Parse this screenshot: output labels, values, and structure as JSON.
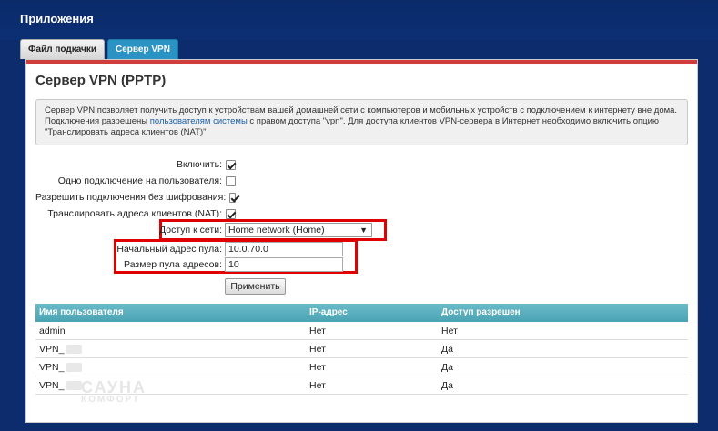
{
  "header": {
    "title": "Приложения"
  },
  "tabs": [
    {
      "label": "Файл подкачки",
      "active": false
    },
    {
      "label": "Сервер VPN",
      "active": true
    }
  ],
  "page": {
    "title": "Сервер VPN (PPTP)",
    "info_part1": "Сервер VPN позволяет получить доступ к устройствам вашей домашней сети с компьютеров и мобильных устройств с подключением к интернету вне дома. Подключения разрешены ",
    "info_link": "пользователям системы",
    "info_part2": " с правом доступа \"vpn\". Для доступа клиентов VPN-сервера в Интернет необходимо включить опцию \"Транслировать адреса клиентов (NAT)\""
  },
  "form": {
    "enable_label": "Включить:",
    "single_conn_label": "Одно подключение на пользователя:",
    "no_encrypt_label": "Разрешить подключения без шифрования:",
    "nat_label": "Транслировать адреса клиентов (NAT):",
    "network_label": "Доступ к сети:",
    "network_value": "Home network (Home)",
    "pool_start_label": "Начальный адрес пула:",
    "pool_start_value": "10.0.70.0",
    "pool_size_label": "Размер пула адресов:",
    "pool_size_value": "10",
    "apply_label": "Применить"
  },
  "table": {
    "headers": [
      "Имя пользователя",
      "IP-адрес",
      "Доступ разрешен"
    ],
    "rows": [
      [
        "admin",
        "Нет",
        "Нет"
      ],
      [
        "VPN_",
        "Нет",
        "Да"
      ],
      [
        "VPN_",
        "Нет",
        "Да"
      ],
      [
        "VPN_",
        "Нет",
        "Да"
      ]
    ]
  },
  "watermark": {
    "line1": "САУНА",
    "line2": "КОМФОРТ"
  }
}
